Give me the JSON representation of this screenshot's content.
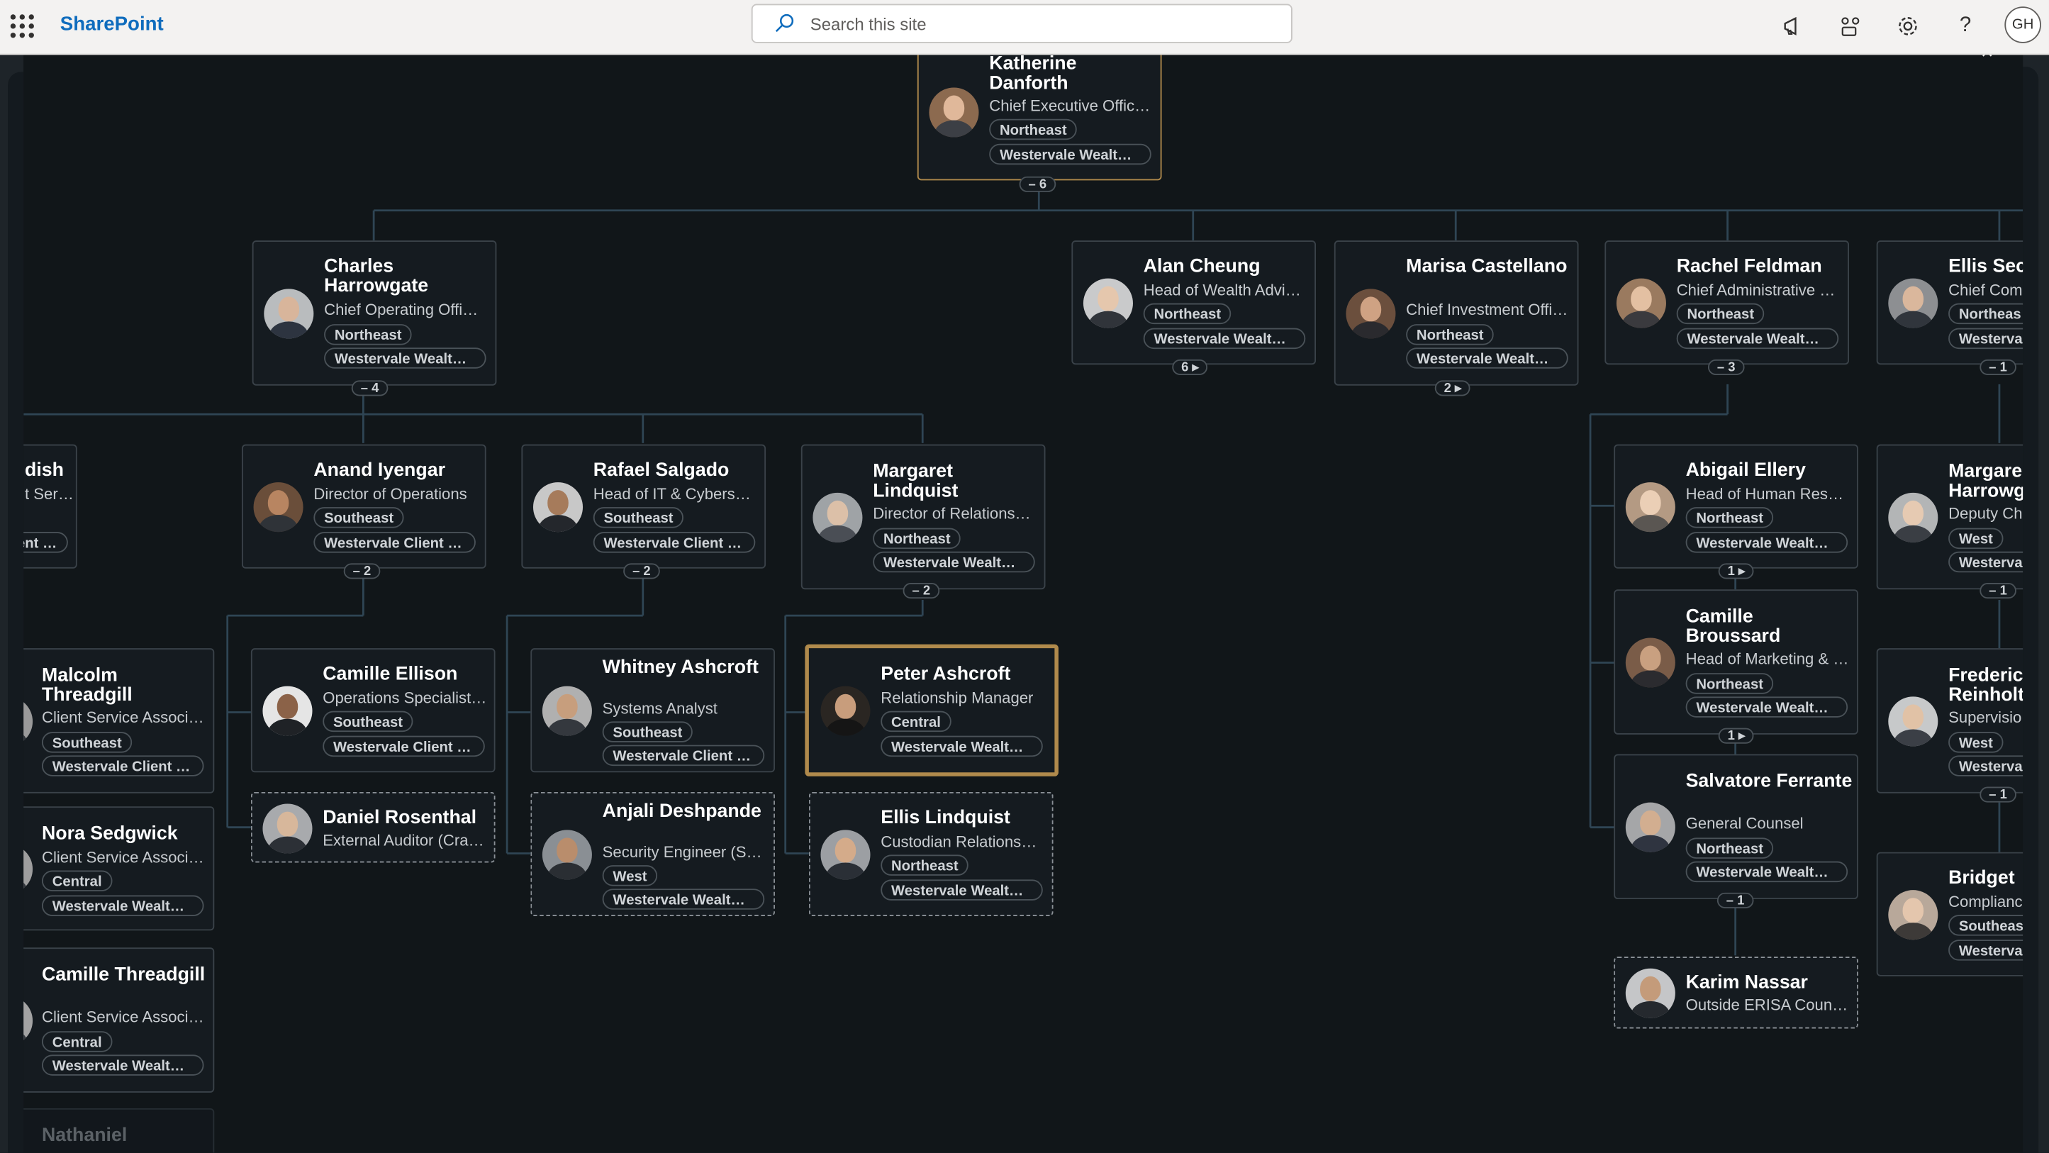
{
  "header": {
    "app_name": "SharePoint",
    "search_placeholder": "Search this site",
    "user_initials": "GH"
  },
  "toolbar": {
    "icons": [
      "megaphone-icon",
      "share-icon",
      "settings-icon",
      "help-icon"
    ]
  },
  "close_label": "×",
  "people": {
    "katherine": {
      "name": "Katherine Danforth",
      "title": "Chief Executive Offic…",
      "region": "Northeast",
      "company": "Westervale Wealt…",
      "count": "– 6"
    },
    "charles": {
      "name": "Charles Harrowgate",
      "title": "Chief Operating Offi…",
      "region": "Northeast",
      "company": "Westervale Wealt…",
      "count": "– 4"
    },
    "alan": {
      "name": "Alan Cheung",
      "title": "Head of Wealth Advi…",
      "region": "Northeast",
      "company": "Westervale Wealt…",
      "count": "6 ▸"
    },
    "marisa": {
      "name": "Marisa Castellano",
      "title": "Chief Investment Offi…",
      "region": "Northeast",
      "company": "Westervale Wealt…",
      "count": "2 ▸"
    },
    "rachel": {
      "name": "Rachel Feldman",
      "title": "Chief Administrative …",
      "region": "Northeast",
      "company": "Westervale Wealt…",
      "count": "– 3"
    },
    "ellis_s": {
      "name": "Ellis Sec",
      "title": "Chief Com",
      "region": "Northeas",
      "company": "Westerva",
      "count": "– 1"
    },
    "cutoff_dish": {
      "name": "dish",
      "title": "t Ser…",
      "company": "ent …"
    },
    "anand": {
      "name": "Anand Iyengar",
      "title": "Director of Operations",
      "region": "Southeast",
      "company": "Westervale Client …",
      "count": "– 2"
    },
    "rafael": {
      "name": "Rafael Salgado",
      "title": "Head of IT & Cybers…",
      "region": "Southeast",
      "company": "Westervale Client …",
      "count": "– 2"
    },
    "margaret_l": {
      "name": "Margaret Lindquist",
      "title": "Director of Relations…",
      "region": "Northeast",
      "company": "Westervale Wealt…",
      "count": "– 2"
    },
    "abigail": {
      "name": "Abigail Ellery",
      "title": "Head of Human Reso…",
      "region": "Northeast",
      "company": "Westervale Wealt…",
      "count": "1 ▸"
    },
    "margaret_h": {
      "name": "Margare Harrowg",
      "title": "Deputy Ch",
      "region": "West",
      "company": "Westerva",
      "count": "– 1"
    },
    "malcolm": {
      "name": "Malcolm Threadgill",
      "title": "Client Service Associ…",
      "region": "Southeast",
      "company": "Westervale Client …"
    },
    "camille_e": {
      "name": "Camille Ellison",
      "title": "Operations Specialist…",
      "region": "Southeast",
      "company": "Westervale Client …"
    },
    "whitney": {
      "name": "Whitney Ashcroft",
      "title": "Systems Analyst",
      "region": "Southeast",
      "company": "Westervale Client …"
    },
    "peter": {
      "name": "Peter Ashcroft",
      "title": "Relationship Manager",
      "region": "Central",
      "company": "Westervale Wealt…"
    },
    "camille_b": {
      "name": "Camille Broussard",
      "title": "Head of Marketing & …",
      "region": "Northeast",
      "company": "Westervale Wealt…",
      "count": "1 ▸"
    },
    "frederic": {
      "name": "Frederic Reinholt",
      "title": "Supervisio",
      "region": "West",
      "company": "Westerva",
      "count": "– 1"
    },
    "daniel": {
      "name": "Daniel Rosenthal",
      "title": "External Auditor (Cra…"
    },
    "anjali": {
      "name": "Anjali Deshpande",
      "title": "Security Engineer (S…",
      "region": "West",
      "company": "Westervale Wealt…"
    },
    "ellis_l": {
      "name": "Ellis Lindquist",
      "title": "Custodian Relationsh…",
      "region": "Northeast",
      "company": "Westervale Wealt…"
    },
    "salvatore": {
      "name": "Salvatore Ferrante",
      "title": "General Counsel",
      "region": "Northeast",
      "company": "Westervale Wealt…",
      "count": "– 1"
    },
    "bridget": {
      "name": "Bridget",
      "title": "Complianc",
      "region": "Southeas",
      "company": "Westerva"
    },
    "nora": {
      "name": "Nora Sedgwick",
      "title": "Client Service Associ…",
      "region": "Central",
      "company": "Westervale Wealt…"
    },
    "camille_t": {
      "name": "Camille Threadgill",
      "title": "Client Service Associ…",
      "region": "Central",
      "company": "Westervale Wealt…"
    },
    "karim": {
      "name": "Karim Nassar",
      "title": "Outside ERISA Coun…"
    },
    "nathaniel": {
      "name": "Nathaniel"
    }
  }
}
